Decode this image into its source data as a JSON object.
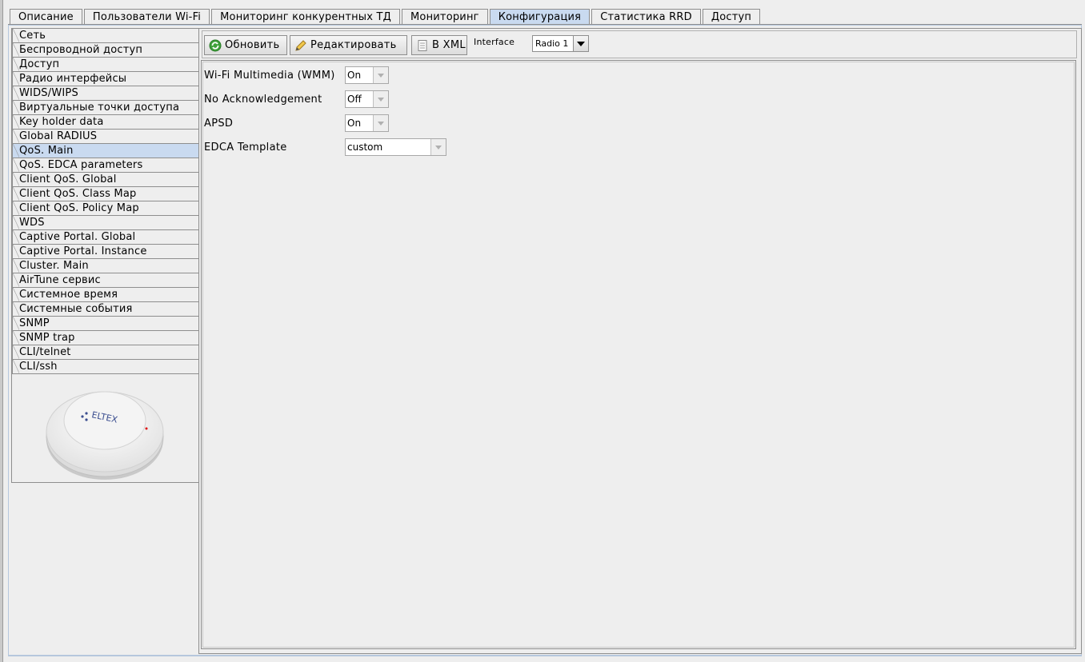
{
  "tabs": [
    {
      "label": "Описание"
    },
    {
      "label": "Пользователи Wi-Fi"
    },
    {
      "label": "Мониторинг конкурентных ТД"
    },
    {
      "label": "Мониторинг"
    },
    {
      "label": "Конфигурация",
      "active": true
    },
    {
      "label": "Статистика RRD"
    },
    {
      "label": "Доступ"
    }
  ],
  "sidebar": {
    "active_index": 8,
    "items": [
      {
        "label": "Сеть"
      },
      {
        "label": "Беспроводной доступ"
      },
      {
        "label": "Доступ"
      },
      {
        "label": "Радио интерфейсы"
      },
      {
        "label": "WIDS/WIPS"
      },
      {
        "label": "Виртуальные точки доступа"
      },
      {
        "label": "Key holder data"
      },
      {
        "label": "Global RADIUS"
      },
      {
        "label": "QoS. Main"
      },
      {
        "label": "QoS. EDCA parameters"
      },
      {
        "label": "Client QoS. Global"
      },
      {
        "label": "Client QoS. Class Map"
      },
      {
        "label": "Client QoS. Policy Map"
      },
      {
        "label": "WDS"
      },
      {
        "label": "Captive Portal. Global"
      },
      {
        "label": "Captive Portal. Instance"
      },
      {
        "label": "Cluster. Main"
      },
      {
        "label": "AirTune сервис"
      },
      {
        "label": "Системное время"
      },
      {
        "label": "Системные события"
      },
      {
        "label": "SNMP"
      },
      {
        "label": "SNMP trap"
      },
      {
        "label": "CLI/telnet"
      },
      {
        "label": "CLI/ssh"
      }
    ],
    "device_logo": "ELTEX"
  },
  "toolbar": {
    "refresh_label": "Обновить",
    "edit_label": "Редактировать",
    "xml_label": "В XML",
    "interface_label": "Interface",
    "interface_value": "Radio 1"
  },
  "form": {
    "wmm_label": "Wi-Fi Multimedia (WMM)",
    "wmm_value": "On",
    "noack_label": "No Acknowledgement",
    "noack_value": "Off",
    "apsd_label": "APSD",
    "apsd_value": "On",
    "edca_label": "EDCA Template",
    "edca_value": "custom"
  },
  "colors": {
    "active_tab": "#c9daf0",
    "active_item": "#c9daf0",
    "background": "#eeeeee"
  }
}
